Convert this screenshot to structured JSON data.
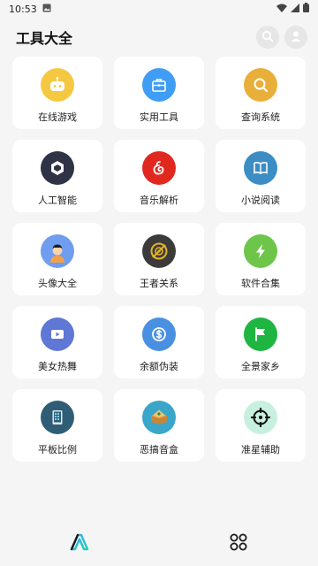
{
  "status_bar": {
    "time": "10:53",
    "icons": [
      "gallery-icon",
      "wifi-icon",
      "signal-icon",
      "battery-icon"
    ]
  },
  "header": {
    "title": "工具大全",
    "actions": [
      "search-icon",
      "user-icon"
    ]
  },
  "tools": [
    {
      "label": "在线游戏",
      "icon": "gamepad-icon",
      "color": "#f5c842"
    },
    {
      "label": "实用工具",
      "icon": "toolbox-icon",
      "color": "#3f9df5"
    },
    {
      "label": "查询系统",
      "icon": "magnifier-icon",
      "color": "#e8b03a"
    },
    {
      "label": "人工智能",
      "icon": "ai-logo-icon",
      "color": "#2f3346"
    },
    {
      "label": "音乐解析",
      "icon": "music-icon",
      "color": "#e0281f"
    },
    {
      "label": "小说阅读",
      "icon": "book-icon",
      "color": "#3c8dc4"
    },
    {
      "label": "头像大全",
      "icon": "avatar-icon",
      "color": "#6f9df0"
    },
    {
      "label": "王者关系",
      "icon": "game-emblem-icon",
      "color": "#3b3b3b"
    },
    {
      "label": "软件合集",
      "icon": "lightning-icon",
      "color": "#6dc64a"
    },
    {
      "label": "美女热舞",
      "icon": "video-icon",
      "color": "#5f78d6"
    },
    {
      "label": "余额伪装",
      "icon": "dollar-icon",
      "color": "#4a90e2"
    },
    {
      "label": "全景家乡",
      "icon": "flag-icon",
      "color": "#1fb541"
    },
    {
      "label": "平板比例",
      "icon": "tablet-icon",
      "color": "#2f5d76"
    },
    {
      "label": "恶搞音盒",
      "icon": "music-box-icon",
      "color": "#3aa6c9"
    },
    {
      "label": "准星辅助",
      "icon": "crosshair-icon",
      "color": "#c8f0df"
    }
  ],
  "bottom_nav": [
    "home-logo-icon",
    "apps-grid-icon"
  ]
}
